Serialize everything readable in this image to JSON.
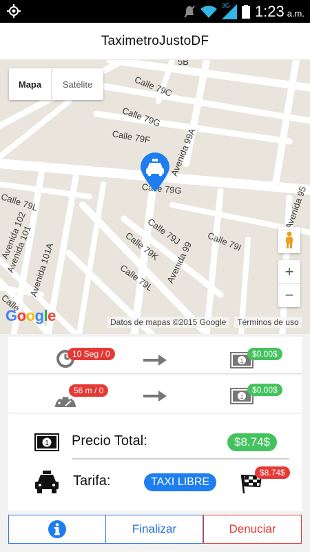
{
  "status_bar": {
    "time": "1:23",
    "ampm": "a.m.",
    "network_label": "3G",
    "icons": [
      "gps-target-icon",
      "mute-icon",
      "wifi-icon",
      "signal-icon",
      "battery-icon"
    ]
  },
  "app": {
    "title": "TaximetroJustoDF"
  },
  "map": {
    "type_buttons": {
      "map": "Mapa",
      "satellite": "Satélite"
    },
    "streets": {
      "calle_79c": "Calle 79C",
      "calle_79g_top": "Calle 79G",
      "calle_79f": "Calle 79F",
      "avenida_99a": "Avenida 99A",
      "calle_79g_mid": "Calle 79G",
      "calle_79l_left": "Calle 79L",
      "avenida_102": "Avenida 102",
      "avenida_101": "Avenida 101",
      "avenida_101a": "Avenida 101A",
      "calle_79j": "Calle 79J",
      "calle_79k": "Calle 79K",
      "avenida_99": "Avenida 99",
      "calle_79i": "Calle 79I",
      "avenida_95": "Avenida 95",
      "calle_79l_bottom": "Calle 79L",
      "calle_top": "Calle",
      "top_fragment": "5B"
    },
    "zoom_in": "+",
    "zoom_out": "−",
    "logo_letters": [
      "G",
      "o",
      "o",
      "g",
      "l",
      "e"
    ],
    "attribution": "Datos de mapas ©2015 Google",
    "terms": "Términos de uso"
  },
  "meter": {
    "time_badge": "10 Seg / 0",
    "time_cost": "$0.00$",
    "distance_badge": "56 m / 0",
    "distance_cost": "$0.00$",
    "total_label": "Precio Total:",
    "total_value": "$8.74$",
    "tariff_label": "Tarifa:",
    "tariff_value": "TAXI LIBRE",
    "flag_badge": "$8.74$"
  },
  "actions": {
    "finish": "Finalizar",
    "report": "Denuciar"
  },
  "colors": {
    "blue": "#1e7df0",
    "green": "#43c35e",
    "red": "#e53935",
    "map_bg": "#e9e5dc"
  }
}
